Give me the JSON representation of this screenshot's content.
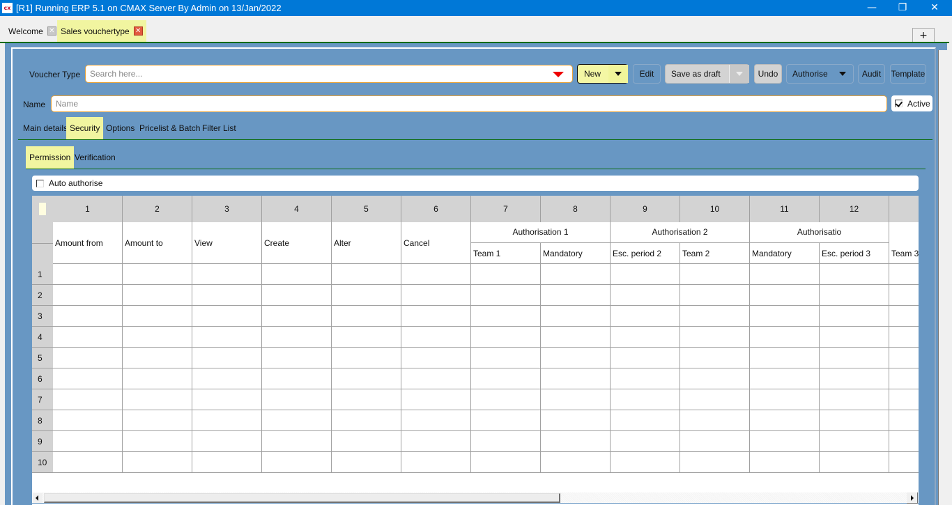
{
  "window": {
    "app_icon_label": "cx",
    "title": "[R1] Running ERP 5.1 on CMAX Server By Admin on 13/Jan/2022",
    "minimize_glyph": "—",
    "restore_glyph": "❐",
    "close_glyph": "✕"
  },
  "doc_tabs": [
    {
      "label": "Welcome",
      "close_glyph": "✕",
      "active": false
    },
    {
      "label": "Sales vouchertype",
      "close_glyph": "✕",
      "active": true
    }
  ],
  "add_tab_glyph": "+",
  "form": {
    "voucher_type_label": "Voucher Type",
    "voucher_type_placeholder": "Search here...",
    "name_label": "Name",
    "name_placeholder": "Name",
    "active_label": "Active",
    "active_checked": true
  },
  "toolbar": {
    "new_label": "New",
    "edit_label": "Edit",
    "save_draft_label": "Save as draft",
    "undo_label": "Undo",
    "authorise_label": "Authorise",
    "audit_label": "Audit",
    "template_label": "Template"
  },
  "main_tabs": [
    {
      "label": "Main details",
      "selected": false
    },
    {
      "label": "Security",
      "selected": true
    },
    {
      "label": "Options",
      "selected": false
    },
    {
      "label": "Pricelist & Batch",
      "selected": false
    },
    {
      "label": "Filter List",
      "selected": false
    }
  ],
  "sub_tabs": [
    {
      "label": "Permission",
      "selected": true
    },
    {
      "label": "Verification",
      "selected": false
    }
  ],
  "auto_authorise": {
    "label": "Auto authorise",
    "checked": false
  },
  "grid": {
    "column_numbers": [
      "1",
      "2",
      "3",
      "4",
      "5",
      "6",
      "7",
      "8",
      "9",
      "10",
      "11",
      "12",
      ""
    ],
    "main_headers": [
      "Amount from",
      "Amount to",
      "View",
      "Create",
      "Alter",
      "Cancel"
    ],
    "groups": [
      {
        "label": "Authorisation 1"
      },
      {
        "label": "Authorisation 2"
      },
      {
        "label": "Authorisatio"
      }
    ],
    "sub_headers": [
      "Team 1",
      "Mandatory",
      "Esc. period 2",
      "Team 2",
      "Mandatory",
      "Esc. period 3",
      "Team 3"
    ],
    "row_numbers": [
      "1",
      "2",
      "3",
      "4",
      "5",
      "6",
      "7",
      "8",
      "9",
      "10"
    ]
  }
}
